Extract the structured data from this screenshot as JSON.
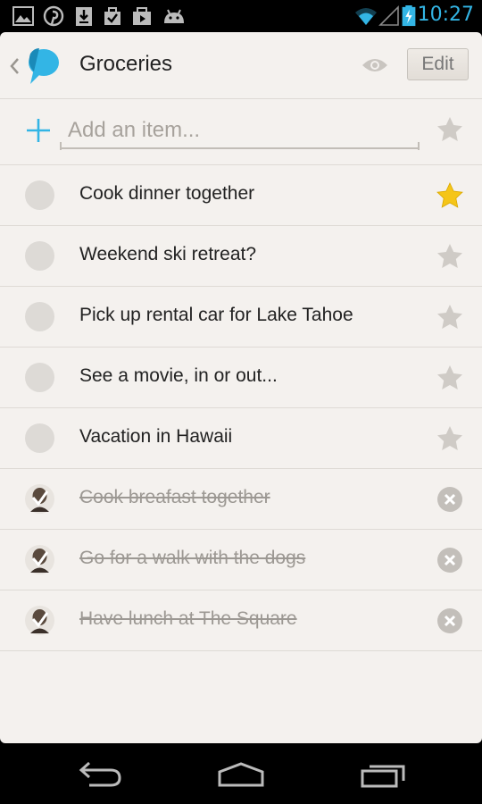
{
  "status_bar": {
    "time": "10:27",
    "notification_icons": [
      "image-icon",
      "pinterest-icon",
      "download-icon",
      "checklist-icon",
      "play-store-icon",
      "android-icon"
    ],
    "system_icons": [
      "wifi-icon",
      "signal-icon",
      "battery-charging-icon"
    ],
    "accent_color": "#33b5e5"
  },
  "header": {
    "title": "Groceries",
    "edit_label": "Edit"
  },
  "add_row": {
    "placeholder": "Add an item..."
  },
  "items": [
    {
      "text": "Cook dinner together",
      "done": false,
      "starred": true
    },
    {
      "text": "Weekend ski retreat?",
      "done": false,
      "starred": false
    },
    {
      "text": "Pick up rental car for Lake Tahoe",
      "done": false,
      "starred": false
    },
    {
      "text": "See a movie, in or out...",
      "done": false,
      "starred": false
    },
    {
      "text": "Vacation in Hawaii",
      "done": false,
      "starred": false
    },
    {
      "text": "Cook breafast together",
      "done": true
    },
    {
      "text": "Go for a walk with the dogs",
      "done": true
    },
    {
      "text": "Have lunch at The Square",
      "done": true
    }
  ],
  "colors": {
    "accent_blue": "#33b5e5",
    "star_active": "#f5c518",
    "star_inactive": "#cfcbc6",
    "background": "#f4f1ee"
  },
  "nav_bar": {
    "buttons": [
      "back-icon",
      "home-icon",
      "recent-apps-icon"
    ]
  }
}
